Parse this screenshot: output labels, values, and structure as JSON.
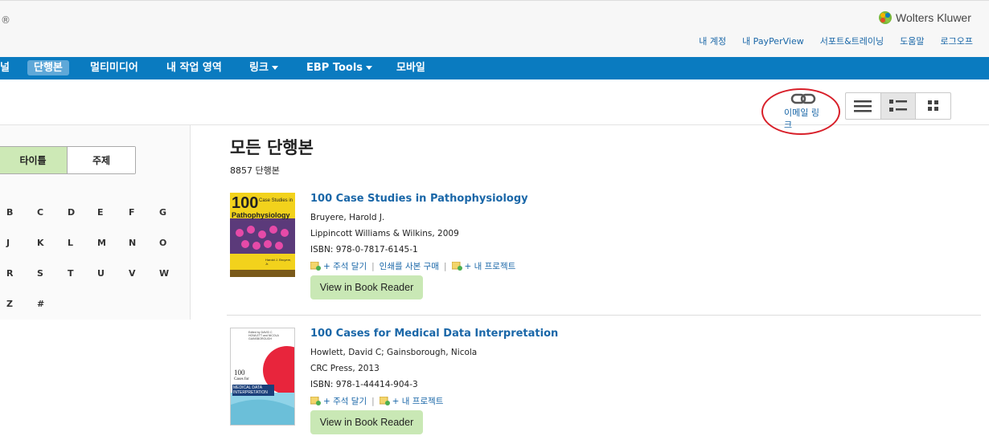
{
  "header": {
    "reg_mark": "®",
    "logo_text": "Wolters Kluwer",
    "user_links": [
      "내 계정",
      "내 PayPerView",
      "서포트&트레이닝",
      "도움말",
      "로그오프"
    ]
  },
  "nav": {
    "items": [
      {
        "label": "널"
      },
      {
        "label": "단행본"
      },
      {
        "label": "멀티미디어"
      },
      {
        "label": "내 작업 영역"
      },
      {
        "label": "링크"
      },
      {
        "label": "EBP Tools"
      },
      {
        "label": "모바일"
      }
    ]
  },
  "toolbar": {
    "email_link_label": "이메일 링크"
  },
  "sidebar": {
    "toggle": {
      "title": "타이틀",
      "subject": "주제"
    },
    "letters": [
      "B",
      "C",
      "D",
      "E",
      "F",
      "G",
      "J",
      "K",
      "L",
      "M",
      "N",
      "O",
      "R",
      "S",
      "T",
      "U",
      "V",
      "W",
      "Z",
      "#"
    ]
  },
  "main": {
    "title": "모든 단행본",
    "count": "8857 단행본",
    "books": [
      {
        "title": "100 Case Studies in Pathophysiology",
        "author": "Bruyere, Harold J.",
        "publisher": "Lippincott Williams & Wilkins, 2009",
        "isbn": "ISBN: 978-0-7817-6145-1",
        "action_annotate": "+ 주석 달기",
        "action_print": "인쇄를 사본 구매",
        "action_project": "+ 내 프로젝트",
        "reader_button": "View in Book Reader",
        "cover_big": "100",
        "cover_line1": "Case Studies in",
        "cover_line2": "Pathophysiology",
        "cover_author": "Harold J. Bruyere, Jr."
      },
      {
        "title": "100 Cases for Medical Data Interpretation",
        "author": "Howlett, David C; Gainsborough, Nicola",
        "publisher": "CRC Press, 2013",
        "isbn": "ISBN: 978-1-44414-904-3",
        "action_annotate": "+ 주석 달기",
        "action_project": "+ 내 프로젝트",
        "reader_button": "View in Book Reader",
        "cover_editors": "Edited by DAVID C HOWLETT and NICOLA GAINSBOROUGH",
        "cover_big": "100",
        "cover_line1": "Cases for",
        "cover_line2": "MEDICAL DATA INTERPRETATION"
      }
    ]
  },
  "colors": {
    "nav_bg": "#0a7bc0",
    "link": "#1a67a8",
    "button_green": "#c9e8b5",
    "annotation_circle": "#d8202a"
  }
}
